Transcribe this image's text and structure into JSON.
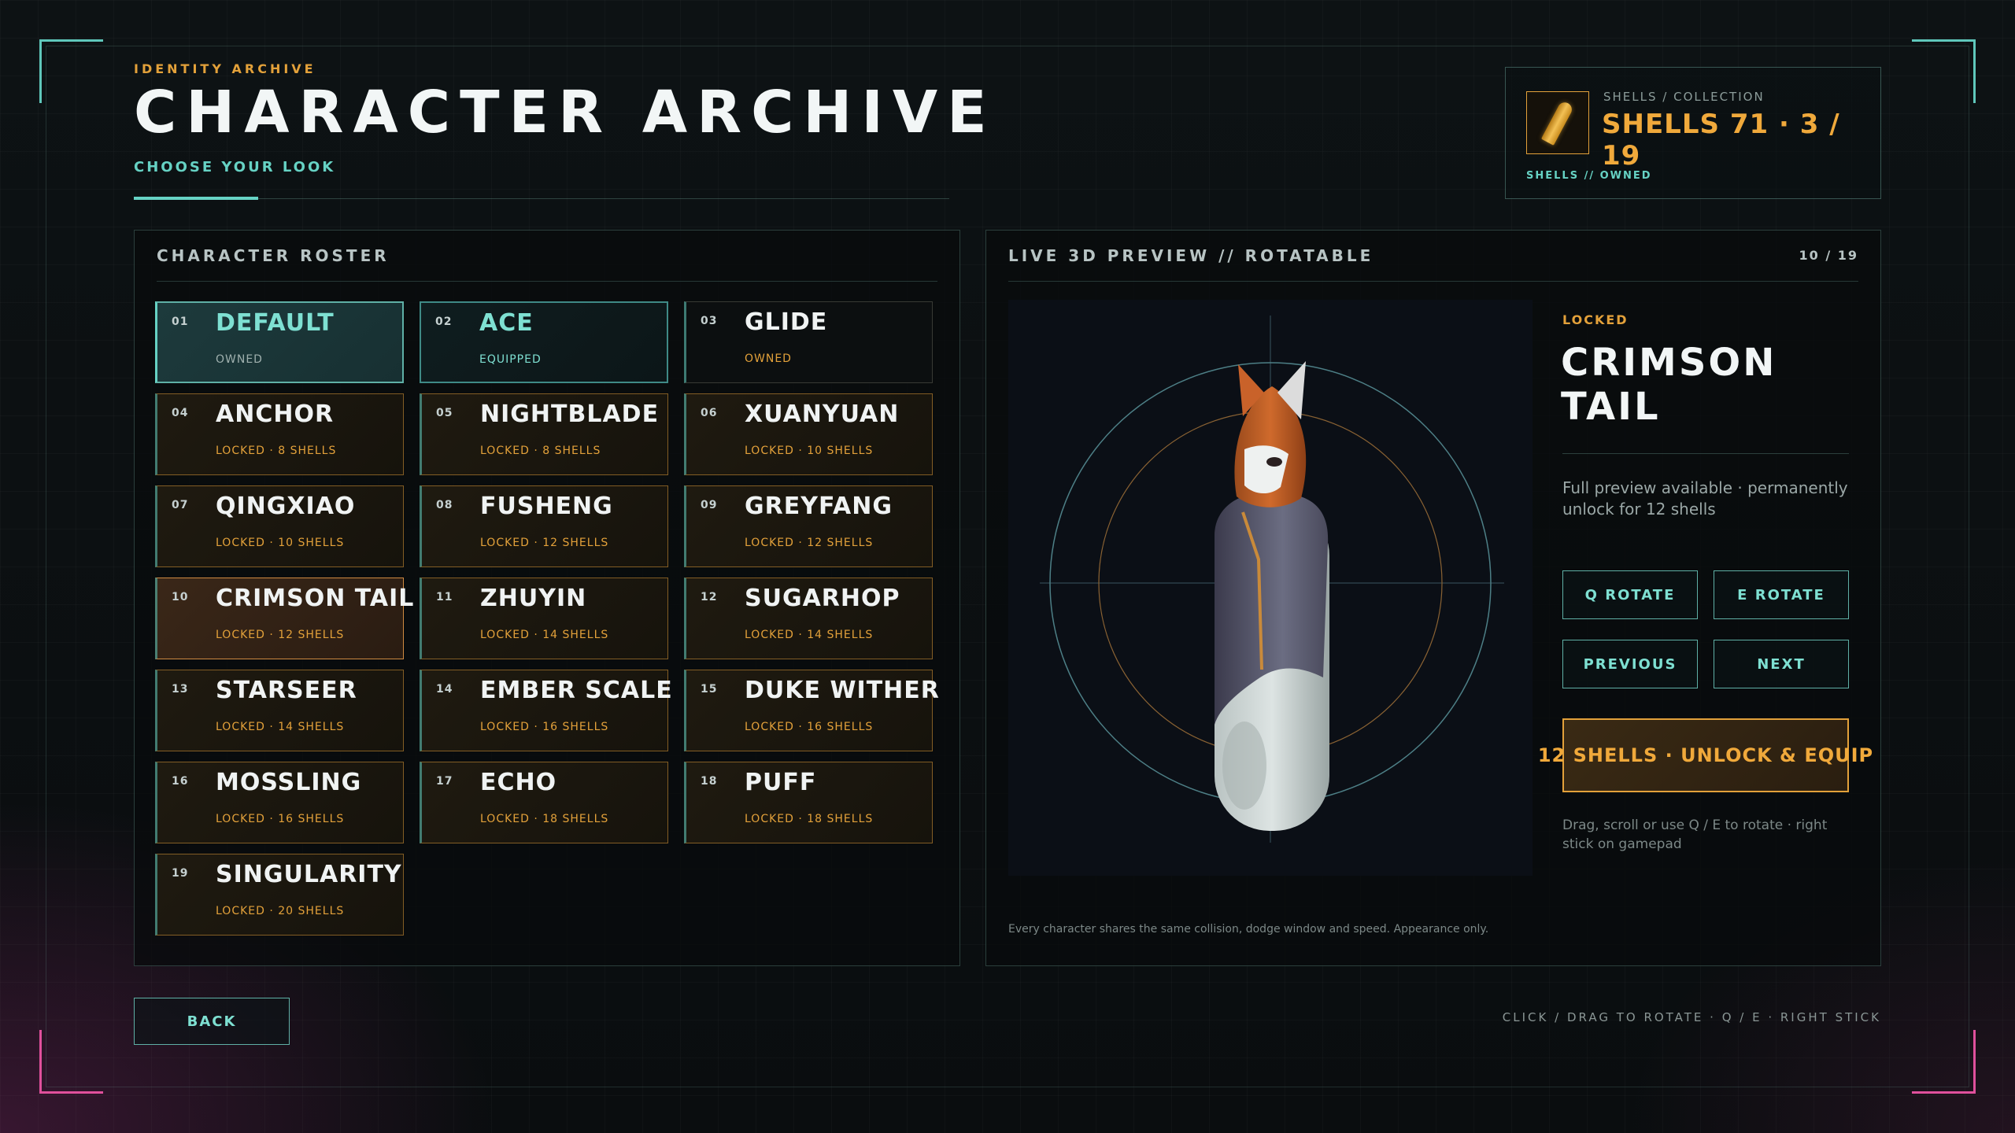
{
  "header": {
    "kicker": "IDENTITY ARCHIVE",
    "title": "CHARACTER ARCHIVE",
    "subtitle": "CHOOSE YOUR LOOK"
  },
  "shells": {
    "kicker": "SHELLS / COLLECTION",
    "value": "SHELLS 71 · 3 / 19",
    "owned_label": "SHELLS // OWNED",
    "icon": "shell-bullet-icon"
  },
  "roster": {
    "title": "CHARACTER ROSTER",
    "characters": [
      {
        "num": "01",
        "name": "DEFAULT",
        "status": "OWNED",
        "state": "selected-owned"
      },
      {
        "num": "02",
        "name": "ACE",
        "status": "EQUIPPED",
        "state": "equipped"
      },
      {
        "num": "03",
        "name": "GLIDE",
        "status": "OWNED",
        "state": "owned"
      },
      {
        "num": "04",
        "name": "ANCHOR",
        "status": "LOCKED · 8 SHELLS",
        "state": "locked"
      },
      {
        "num": "05",
        "name": "NIGHTBLADE",
        "status": "LOCKED · 8 SHELLS",
        "state": "locked"
      },
      {
        "num": "06",
        "name": "XUANYUAN",
        "status": "LOCKED · 10 SHELLS",
        "state": "locked"
      },
      {
        "num": "07",
        "name": "QINGXIAO",
        "status": "LOCKED · 10 SHELLS",
        "state": "locked"
      },
      {
        "num": "08",
        "name": "FUSHENG",
        "status": "LOCKED · 12 SHELLS",
        "state": "locked"
      },
      {
        "num": "09",
        "name": "GREYFANG",
        "status": "LOCKED · 12 SHELLS",
        "state": "locked"
      },
      {
        "num": "10",
        "name": "CRIMSON TAIL",
        "status": "LOCKED · 12 SHELLS",
        "state": "current"
      },
      {
        "num": "11",
        "name": "ZHUYIN",
        "status": "LOCKED · 14 SHELLS",
        "state": "locked"
      },
      {
        "num": "12",
        "name": "SUGARHOP",
        "status": "LOCKED · 14 SHELLS",
        "state": "locked"
      },
      {
        "num": "13",
        "name": "STARSEER",
        "status": "LOCKED · 14 SHELLS",
        "state": "locked"
      },
      {
        "num": "14",
        "name": "EMBER SCALE",
        "status": "LOCKED · 16 SHELLS",
        "state": "locked"
      },
      {
        "num": "15",
        "name": "DUKE WITHER",
        "status": "LOCKED · 16 SHELLS",
        "state": "locked"
      },
      {
        "num": "16",
        "name": "MOSSLING",
        "status": "LOCKED · 16 SHELLS",
        "state": "locked"
      },
      {
        "num": "17",
        "name": "ECHO",
        "status": "LOCKED · 18 SHELLS",
        "state": "locked"
      },
      {
        "num": "18",
        "name": "PUFF",
        "status": "LOCKED · 18 SHELLS",
        "state": "locked"
      },
      {
        "num": "19",
        "name": "SINGULARITY",
        "status": "LOCKED · 20 SHELLS",
        "state": "locked"
      }
    ]
  },
  "preview": {
    "title": "LIVE 3D PREVIEW // ROTATABLE",
    "count": "10 / 19",
    "lock_tag": "LOCKED",
    "character_name": "CRIMSON TAIL",
    "description": "Full preview available · permanently unlock for 12 shells",
    "buttons": {
      "rotate_q": "Q ROTATE",
      "rotate_e": "E ROTATE",
      "previous": "PREVIOUS",
      "next": "NEXT",
      "unlock": "12 SHELLS · UNLOCK & EQUIP"
    },
    "hint": "Drag, scroll or use Q / E to rotate · right stick on gamepad",
    "footnote": "Every character shares the same collision, dodge window and speed. Appearance only.",
    "model_icon": "fox-character-model"
  },
  "footer": {
    "back": "BACK",
    "controls": "CLICK / DRAG TO ROTATE · Q / E · RIGHT STICK"
  },
  "colors": {
    "accent_teal": "#66d2c4",
    "accent_orange": "#e3a13a",
    "corner_pink": "#e0509c",
    "background": "#0a0d0f"
  }
}
